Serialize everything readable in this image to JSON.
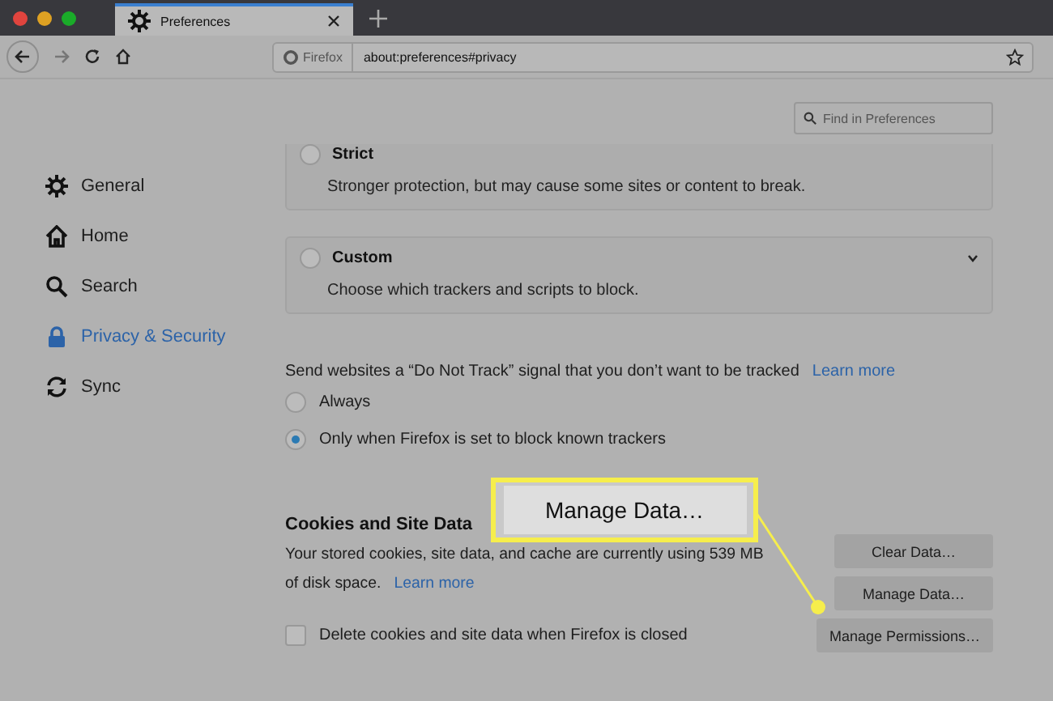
{
  "window": {
    "tab": {
      "title": "Preferences"
    }
  },
  "toolbar": {
    "identity": "Firefox",
    "url": "about:preferences#privacy"
  },
  "search": {
    "placeholder": "Find in Preferences"
  },
  "sidebar": {
    "items": [
      {
        "label": "General",
        "kind": "gear",
        "selected": false
      },
      {
        "label": "Home",
        "kind": "home",
        "selected": false
      },
      {
        "label": "Search",
        "kind": "search",
        "selected": false
      },
      {
        "label": "Privacy & Security",
        "kind": "lock",
        "selected": true
      },
      {
        "label": "Sync",
        "kind": "sync",
        "selected": false
      }
    ]
  },
  "tracking": {
    "options": [
      {
        "label": "Strict",
        "description": "Stronger protection, but may cause some sites or content to break.",
        "selected": false,
        "expandable": false
      },
      {
        "label": "Custom",
        "description": "Choose which trackers and scripts to block.",
        "selected": false,
        "expandable": true
      }
    ]
  },
  "do_not_track": {
    "text": "Send websites a “Do Not Track” signal that you don’t want to be tracked",
    "link": "Learn more",
    "options": [
      {
        "label": "Always",
        "selected": false
      },
      {
        "label": "Only when Firefox is set to block known trackers",
        "selected": true
      }
    ]
  },
  "cookies": {
    "heading": "Cookies and Site Data",
    "text": "Your stored cookies, site data, and cache are currently using 539 MB of disk space.",
    "link": "Learn more",
    "checkbox": {
      "label": "Delete cookies and site data when Firefox is closed",
      "checked": false
    },
    "buttons": [
      "Clear Data…",
      "Manage Data…",
      "Manage Permissions…"
    ]
  },
  "callout": {
    "label": "Manage Data…"
  }
}
